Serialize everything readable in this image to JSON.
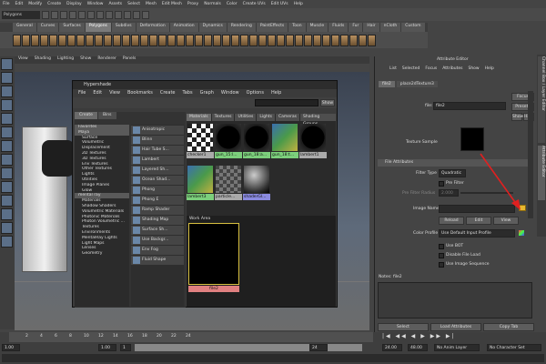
{
  "menubar": [
    "File",
    "Edit",
    "Modify",
    "Create",
    "Display",
    "Window",
    "Assets",
    "Select",
    "Mesh",
    "Edit Mesh",
    "Proxy",
    "Normals",
    "Color",
    "Create UVs",
    "Edit UVs",
    "Help"
  ],
  "status": {
    "mode": "Polygons"
  },
  "shelf": {
    "tabs": [
      "General",
      "Curves",
      "Surfaces",
      "Polygons",
      "Subdivs",
      "Deformation",
      "Animation",
      "Dynamics",
      "Rendering",
      "PaintEffects",
      "Toon",
      "Muscle",
      "Fluids",
      "Fur",
      "Hair",
      "nCloth",
      "Custom"
    ],
    "active": "Polygons"
  },
  "viewport": {
    "menu": [
      "View",
      "Shading",
      "Lighting",
      "Show",
      "Renderer",
      "Panels"
    ],
    "corner_label": "persp"
  },
  "hypershade": {
    "title": "Hypershade",
    "menu": [
      "File",
      "Edit",
      "View",
      "Bookmarks",
      "Create",
      "Tabs",
      "Graph",
      "Window",
      "Options",
      "Help"
    ],
    "show_label": "Show",
    "left_tabs": [
      "Create",
      "Bins"
    ],
    "tree": [
      {
        "t": "Favorites",
        "cat": true
      },
      {
        "t": "Maya",
        "cat": true
      },
      {
        "t": "Surface"
      },
      {
        "t": "Volumetric"
      },
      {
        "t": "Displacement"
      },
      {
        "t": "2D Textures"
      },
      {
        "t": "3D Textures"
      },
      {
        "t": "Env Textures"
      },
      {
        "t": "Other Textures"
      },
      {
        "t": "Lights"
      },
      {
        "t": "Utilities"
      },
      {
        "t": "Image Planes"
      },
      {
        "t": "Glow"
      },
      {
        "t": "mental ray",
        "cat": true
      },
      {
        "t": "Materials"
      },
      {
        "t": "Shadow Shaders"
      },
      {
        "t": "Volumetric Materials"
      },
      {
        "t": "Photonic Materials"
      },
      {
        "t": "Photon Volumetric ..."
      },
      {
        "t": "Textures"
      },
      {
        "t": "Environments"
      },
      {
        "t": "MentalRay Lights"
      },
      {
        "t": "Light Maps"
      },
      {
        "t": "Lenses"
      },
      {
        "t": "Geometry"
      }
    ],
    "node_list": [
      "Anisotropic",
      "Blinn",
      "Hair Tube S...",
      "Lambert",
      "Layered Sh...",
      "Ocean Shad...",
      "Phong",
      "Phong E",
      "Ramp Shader",
      "Shading Map",
      "Surface Sh...",
      "Use Backgr...",
      "Env Fog",
      "Fluid Shape"
    ],
    "right_tabs": [
      "Materials",
      "Textures",
      "Utilities",
      "Lights",
      "Cameras",
      "Shading Groups"
    ],
    "active_tab": "Materials",
    "swatches": [
      {
        "label": "checker1",
        "kind": "checker",
        "sel": false
      },
      {
        "label": "gun_15:l...",
        "kind": "black",
        "sel": true
      },
      {
        "label": "gun_18:a...",
        "kind": "black",
        "sel": true
      },
      {
        "label": "gun_18:t...",
        "kind": "texture",
        "sel": true
      },
      {
        "label": "lambert1",
        "kind": "black",
        "sel": false
      },
      {
        "label": "lambert3",
        "kind": "texture",
        "sel": true
      },
      {
        "label": "particle...",
        "kind": "checker2",
        "sel": false
      },
      {
        "label": "shaderGl...",
        "kind": "sphere",
        "sel": false
      }
    ],
    "work_area_label": "Work Area",
    "work_node": "file2"
  },
  "attr_editor": {
    "title": "Attribute Editor",
    "menu": [
      "List",
      "Selected",
      "Focus",
      "Attributes",
      "Show",
      "Help"
    ],
    "tabs": [
      "file2",
      "place2dTexture3"
    ],
    "file_label": "file:",
    "file_value": "file2",
    "focus": "Focus",
    "presets": "Presets",
    "show": "Show",
    "hide": "Hide",
    "texture_sample": "Texture Sample",
    "section": "File Attributes",
    "filter_type_label": "Filter Type",
    "filter_type_value": "Quadratic",
    "pre_filter": "Pre Filter",
    "pre_filter_radius_label": "Pre Filter Radius",
    "pre_filter_radius_value": "2.000",
    "image_name_label": "Image Name",
    "reload": "Reload",
    "edit": "Edit",
    "view": "View",
    "color_profile_label": "Color Profile",
    "color_profile_value": "Use Default Input Profile",
    "use_bot": "Use BOT",
    "disable_file_load": "Disable File Load",
    "use_image_sequence": "Use Image Sequence",
    "notes_label": "Notes: file2",
    "select": "Select",
    "load_attributes": "Load Attributes",
    "copy_tab": "Copy Tab"
  },
  "right_tabs": [
    "Channel Box / Layer Editor",
    "Attribute Editor"
  ],
  "timeline": {
    "ticks": [
      "2",
      "4",
      "6",
      "8",
      "10",
      "12",
      "14",
      "16",
      "18",
      "20",
      "22",
      "24"
    ],
    "start": "1.00",
    "start2": "1.00",
    "current": "1",
    "end": "24",
    "end_time": "24.00",
    "end2": "48.00",
    "anim_layer": "No Anim Layer",
    "char_set": "No Character Set"
  },
  "colors": {
    "selected_swatch": "#7ccf7c",
    "file_node": "#e08080",
    "arrow": "#e02020"
  }
}
